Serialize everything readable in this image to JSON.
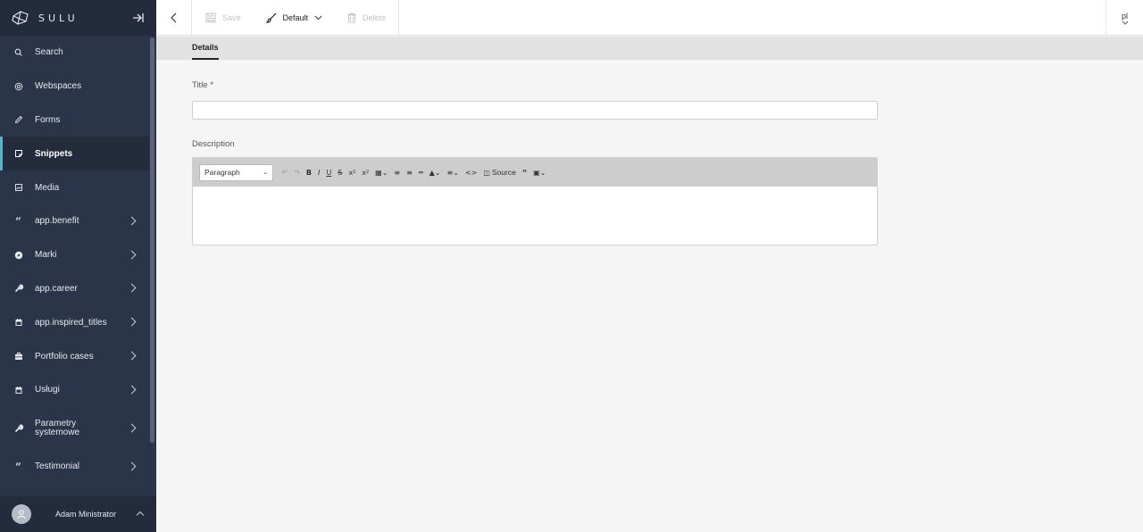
{
  "app": {
    "name": "SULU"
  },
  "sidebar": {
    "items": [
      {
        "label": "Search",
        "icon": "search-icon"
      },
      {
        "label": "Webspaces",
        "icon": "globe-icon"
      },
      {
        "label": "Forms",
        "icon": "pencil-icon"
      },
      {
        "label": "Snippets",
        "icon": "snippet-icon",
        "active": true
      },
      {
        "label": "Media",
        "icon": "media-icon"
      },
      {
        "label": "app.benefit",
        "icon": "quote-icon",
        "expandable": true
      },
      {
        "label": "Marki",
        "icon": "compass-icon",
        "expandable": true
      },
      {
        "label": "app.career",
        "icon": "wrench-icon",
        "expandable": true
      },
      {
        "label": "app.inspired_titles",
        "icon": "calendar-icon",
        "expandable": true
      },
      {
        "label": "Portfolio cases",
        "icon": "briefcase-icon",
        "expandable": true
      },
      {
        "label": "Usługi",
        "icon": "calendar-icon",
        "expandable": true
      },
      {
        "label": "Parametry systemowe",
        "icon": "wrench-icon",
        "expandable": true
      },
      {
        "label": "Testimonial",
        "icon": "quote-icon",
        "expandable": true
      }
    ],
    "user": {
      "name": "Adam Ministrator"
    }
  },
  "toolbar": {
    "save_label": "Save",
    "default_label": "Default",
    "delete_label": "Delete",
    "locale": "pl"
  },
  "tabs": [
    {
      "label": "Details",
      "active": true
    }
  ],
  "form": {
    "title_label": "Title *",
    "title_value": "",
    "description_label": "Description",
    "editor": {
      "format_value": "Paragraph",
      "source_label": "Source"
    }
  },
  "colors": {
    "sidebar_bg": "#2b3549",
    "sidebar_header_bg": "#232b3c",
    "accent": "#52b6ca"
  }
}
